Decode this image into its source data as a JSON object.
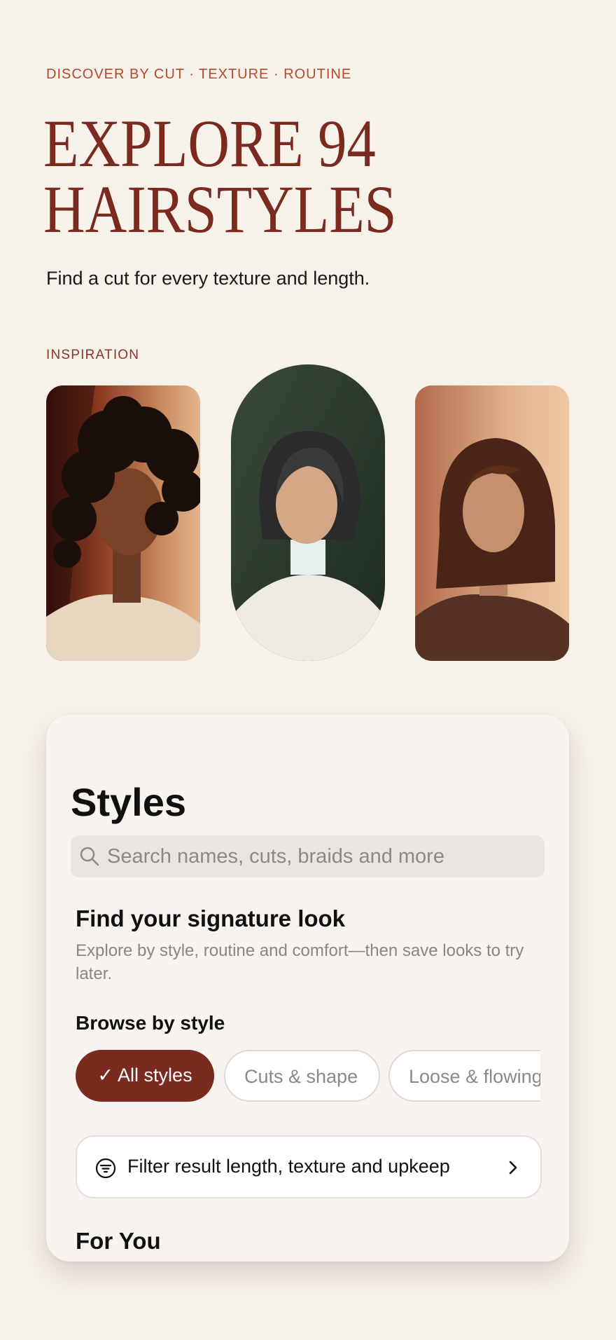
{
  "hero": {
    "eyebrow": "DISCOVER BY CUT · TEXTURE · ROUTINE",
    "title_line1": "EXPLORE 94",
    "title_line2": "HAIRSTYLES",
    "subtitle": "Find a cut for every texture and length."
  },
  "inspiration": {
    "label": "INSPIRATION",
    "portraits": [
      {
        "name": "portrait-curly"
      },
      {
        "name": "portrait-bob"
      },
      {
        "name": "portrait-wavy"
      }
    ]
  },
  "styles": {
    "title": "Styles",
    "search_placeholder": "Search names, cuts, braids and more",
    "signature_title": "Find your signature look",
    "signature_desc": "Explore by style, routine and comfort—then save looks to try later.",
    "browse_label": "Browse by style",
    "chips": [
      {
        "label": "✓ All styles",
        "active": true
      },
      {
        "label": "Cuts & shape",
        "active": false
      },
      {
        "label": "Loose & flowing",
        "active": false
      }
    ],
    "filter_label": "Filter result length, texture and upkeep",
    "for_you": "For You"
  },
  "colors": {
    "accent": "#7a2a1f",
    "eyebrow": "#b4492f",
    "background": "#f6f1e9"
  }
}
